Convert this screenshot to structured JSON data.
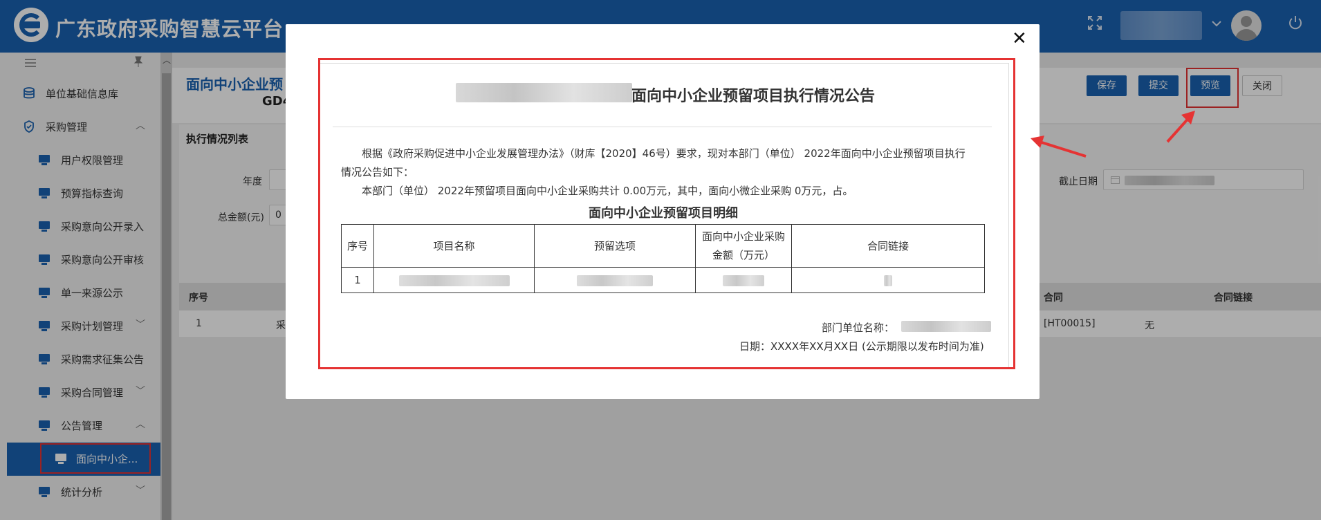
{
  "header": {
    "app_title": "广东政府采购智慧云平台",
    "icons": [
      "expand-icon",
      "chevron-down-icon",
      "power-icon"
    ]
  },
  "sidebar": {
    "items": [
      {
        "label": "单位基础信息库",
        "icon": "database-icon"
      },
      {
        "label": "采购管理",
        "icon": "shield-icon"
      },
      {
        "label": "用户权限管理",
        "icon": "monitor-icon"
      },
      {
        "label": "预算指标查询",
        "icon": "monitor-icon"
      },
      {
        "label": "采购意向公开录入",
        "icon": "monitor-icon"
      },
      {
        "label": "采购意向公开审核",
        "icon": "monitor-icon"
      },
      {
        "label": "单一来源公示",
        "icon": "monitor-icon"
      },
      {
        "label": "采购计划管理",
        "icon": "monitor-icon"
      },
      {
        "label": "采购需求征集公告",
        "icon": "monitor-icon"
      },
      {
        "label": "采购合同管理",
        "icon": "monitor-icon"
      },
      {
        "label": "公告管理",
        "icon": "monitor-icon"
      },
      {
        "label": "面向中小企...",
        "icon": "monitor-icon"
      },
      {
        "label": "统计分析",
        "icon": "monitor-icon"
      }
    ]
  },
  "main": {
    "page_title": "面向中小企业预",
    "page_code": "GD4",
    "buttons": {
      "save": "保存",
      "submit": "提交",
      "preview": "预览",
      "close": "关闭"
    },
    "section_title": "执行情况列表",
    "form": {
      "year_label": "年度",
      "end_date_label": "截止日期",
      "total_label": "总金额(元)",
      "total_value": "0"
    },
    "table": {
      "headers": {
        "index": "序号",
        "contract": "合同",
        "contract_link": "合同链接"
      },
      "row": {
        "index": "1",
        "name_partial": "采",
        "contract": "[HT00015]",
        "contract_link": "无"
      }
    }
  },
  "modal": {
    "doc_title": "面向中小企业预留项目执行情况公告",
    "para1_line1": "根据《政府采购促进中小企业发展管理办法》（财库【2020】46号）要求，现对本部门（单位） 2022年面向中小企业预留项目执行",
    "para1_line2": "情况公告如下：",
    "para2": "本部门（单位） 2022年预留项目面向中小企业采购共计 0.00万元，其中，面向小微企业采购 0万元，占。",
    "detail_title": "面向中小企业预留项目明细",
    "table_headers": [
      "序号",
      "项目名称",
      "预留选项",
      "面向中小企业采购",
      "金额（万元）",
      "合同链接"
    ],
    "table_row_index": "1",
    "dept_label": "部门单位名称：",
    "date_line": "日期：XXXX年XX月XX日 (公示期限以发布时间为准)"
  },
  "colors": {
    "brand": "#1a62b1",
    "highlight": "#e53333"
  }
}
